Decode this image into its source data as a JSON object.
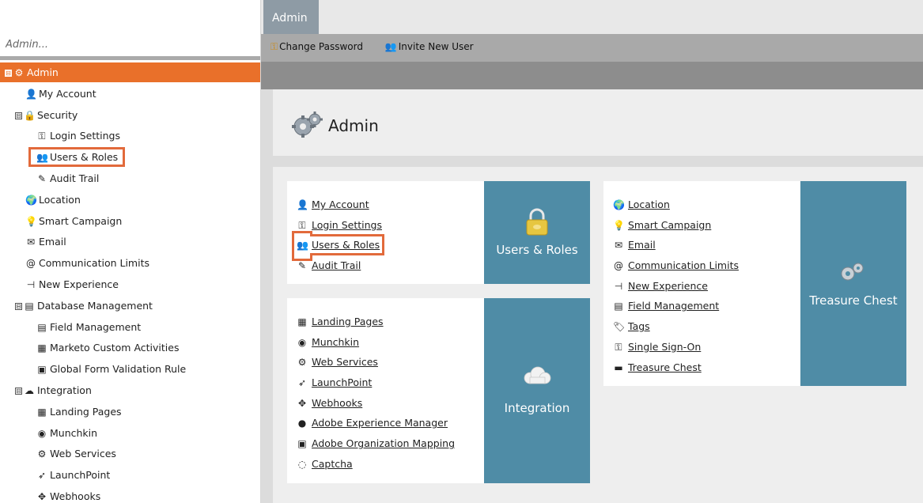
{
  "search": {
    "placeholder": "Admin..."
  },
  "tree": [
    {
      "label": "Admin",
      "icon": "gear-icon",
      "glyph": "⚙",
      "expander": "⊟",
      "level": 0,
      "selected": true
    },
    {
      "label": "My Account",
      "icon": "person-icon",
      "glyph": "👤",
      "level": 1
    },
    {
      "label": "Security",
      "icon": "lock-icon",
      "glyph": "🔒",
      "expander": "⊟",
      "level": 1
    },
    {
      "label": "Login Settings",
      "icon": "key-icon",
      "glyph": "⚿",
      "level": 2
    },
    {
      "label": "Users & Roles",
      "icon": "users-icon",
      "glyph": "👥",
      "level": 2,
      "highlighted": true
    },
    {
      "label": "Audit Trail",
      "icon": "audit-icon",
      "glyph": "✎",
      "level": 2
    },
    {
      "label": "Location",
      "icon": "globe-icon",
      "glyph": "🌍",
      "level": 1
    },
    {
      "label": "Smart Campaign",
      "icon": "lightbulb-icon",
      "glyph": "💡",
      "level": 1
    },
    {
      "label": "Email",
      "icon": "email-icon",
      "glyph": "✉",
      "level": 1
    },
    {
      "label": "Communication Limits",
      "icon": "at-icon",
      "glyph": "@",
      "level": 1
    },
    {
      "label": "New Experience",
      "icon": "new-experience-icon",
      "glyph": "⊣",
      "level": 1
    },
    {
      "label": "Database Management",
      "icon": "database-icon",
      "glyph": "▤",
      "expander": "⊟",
      "level": 1
    },
    {
      "label": "Field Management",
      "icon": "field-icon",
      "glyph": "▤",
      "level": 2
    },
    {
      "label": "Marketo Custom Activities",
      "icon": "activity-icon",
      "glyph": "▦",
      "level": 2
    },
    {
      "label": "Global Form Validation Rule",
      "icon": "form-icon",
      "glyph": "▣",
      "level": 2
    },
    {
      "label": "Integration",
      "icon": "cloud-icon",
      "glyph": "☁",
      "expander": "⊟",
      "level": 1
    },
    {
      "label": "Landing Pages",
      "icon": "landing-page-icon",
      "glyph": "▦",
      "level": 2
    },
    {
      "label": "Munchkin",
      "icon": "munchkin-icon",
      "glyph": "◉",
      "level": 2
    },
    {
      "label": "Web Services",
      "icon": "web-services-icon",
      "glyph": "⚙",
      "level": 2
    },
    {
      "label": "LaunchPoint",
      "icon": "rocket-icon",
      "glyph": "➶",
      "level": 2
    },
    {
      "label": "Webhooks",
      "icon": "webhook-icon",
      "glyph": "✥",
      "level": 2
    }
  ],
  "tabs": [
    {
      "label": "Admin"
    }
  ],
  "toolbar": {
    "change_password": "Change Password",
    "invite_new_user": "Invite New User"
  },
  "header": {
    "title": "Admin"
  },
  "security_card": {
    "links": [
      {
        "label": "My Account",
        "icon": "person-icon",
        "glyph": "👤"
      },
      {
        "label": "Login Settings",
        "icon": "key-icon",
        "glyph": "⚿"
      },
      {
        "label": "Users & Roles",
        "icon": "users-icon",
        "glyph": "👥",
        "highlighted": true
      },
      {
        "label": "Audit Trail",
        "icon": "audit-icon",
        "glyph": "✎"
      }
    ],
    "tile_label": "Users & Roles"
  },
  "integration_card": {
    "links": [
      {
        "label": "Landing Pages",
        "icon": "landing-page-icon",
        "glyph": "▦"
      },
      {
        "label": "Munchkin",
        "icon": "munchkin-icon",
        "glyph": "◉"
      },
      {
        "label": "Web Services",
        "icon": "web-services-icon",
        "glyph": "⚙"
      },
      {
        "label": "LaunchPoint",
        "icon": "rocket-icon",
        "glyph": "➶"
      },
      {
        "label": "Webhooks",
        "icon": "webhook-icon",
        "glyph": "✥"
      },
      {
        "label": "Adobe Experience Manager",
        "icon": "aem-icon",
        "glyph": "●"
      },
      {
        "label": "Adobe Organization Mapping",
        "icon": "adobe-icon",
        "glyph": "▣"
      },
      {
        "label": "Captcha",
        "icon": "captcha-icon",
        "glyph": "◌"
      }
    ],
    "tile_label": "Integration"
  },
  "treasure_card": {
    "links": [
      {
        "label": "Location",
        "icon": "globe-icon",
        "glyph": "🌍"
      },
      {
        "label": "Smart Campaign",
        "icon": "lightbulb-icon",
        "glyph": "💡"
      },
      {
        "label": "Email",
        "icon": "email-icon",
        "glyph": "✉"
      },
      {
        "label": "Communication Limits",
        "icon": "at-icon",
        "glyph": "@"
      },
      {
        "label": "New Experience",
        "icon": "new-experience-icon",
        "glyph": "⊣"
      },
      {
        "label": "Field Management",
        "icon": "field-icon",
        "glyph": "▤"
      },
      {
        "label": "Tags",
        "icon": "tag-icon",
        "glyph": "🏷"
      },
      {
        "label": "Single Sign-On",
        "icon": "key-icon",
        "glyph": "⚿"
      },
      {
        "label": "Treasure Chest",
        "icon": "chest-icon",
        "glyph": "▬"
      }
    ],
    "tile_label": "Treasure Chest"
  },
  "colors": {
    "accent_orange": "#e9702a",
    "highlight_box": "#e26a3b",
    "tile_blue": "#4f8ca6",
    "tab_gray": "#8e9ba5"
  }
}
